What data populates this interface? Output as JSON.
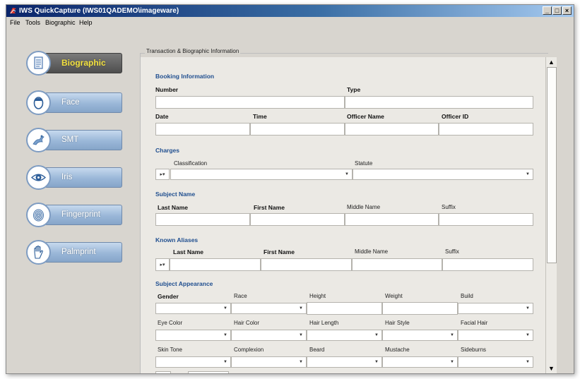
{
  "window": {
    "title": "IWS QuickCapture (IWS01QADEMO\\imageware)",
    "controls": {
      "minimize": "_",
      "maximize": "□",
      "close": "×"
    }
  },
  "menu": [
    "File",
    "Tools",
    "Biographic",
    "Help"
  ],
  "nav": [
    {
      "label": "Biographic",
      "icon": "document-icon",
      "active": true
    },
    {
      "label": "Face",
      "icon": "face-icon",
      "active": false
    },
    {
      "label": "SMT",
      "icon": "tattoo-icon",
      "active": false
    },
    {
      "label": "Iris",
      "icon": "eye-icon",
      "active": false
    },
    {
      "label": "Fingerprint",
      "icon": "fingerprint-icon",
      "active": false
    },
    {
      "label": "Palmprint",
      "icon": "hand-icon",
      "active": false
    }
  ],
  "panel": {
    "group_title": "Transaction & Biographic Information",
    "booking": {
      "title": "Booking Information",
      "number": "Number",
      "type": "Type",
      "date": "Date",
      "time": "Time",
      "officer_name": "Officer Name",
      "officer_id": "Officer ID"
    },
    "charges": {
      "title": "Charges",
      "classification": "Classification",
      "statute": "Statute",
      "expand": "▸▾"
    },
    "subject_name": {
      "title": "Subject Name",
      "last": "Last Name",
      "first": "First Name",
      "middle": "Middle Name",
      "suffix": "Suffix"
    },
    "aliases": {
      "title": "Known Aliases",
      "last": "Last Name",
      "first": "First Name",
      "middle": "Middle Name",
      "suffix": "Suffix",
      "expand": "▸▾"
    },
    "appearance": {
      "title": "Subject Appearance",
      "row1": [
        "Gender",
        "Race",
        "Height",
        "Weight",
        "Build"
      ],
      "row2": [
        "Eye Color",
        "Hair Color",
        "Hair Length",
        "Hair Style",
        "Facial Hair"
      ],
      "row3": [
        "Skin Tone",
        "Complexion",
        "Beard",
        "Mustache",
        "Sideburns"
      ]
    }
  },
  "scrollbar": {
    "up": "▲",
    "down": "▼"
  },
  "colors": {
    "section": "#1f4e8f",
    "active_nav_text": "#f3e13f",
    "titlebar": "#0a246a"
  }
}
